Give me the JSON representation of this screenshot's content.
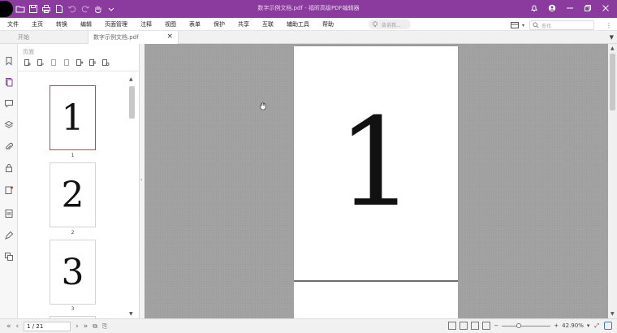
{
  "titlebar": {
    "window_title": "数字示例文档.pdf - 福昕高级PDF编辑器",
    "bg_color": "#8b3a9e"
  },
  "menu": {
    "items": [
      "文件",
      "主页",
      "转换",
      "编辑",
      "页面管理",
      "注释",
      "视图",
      "表单",
      "保护",
      "共享",
      "互联",
      "辅助工具",
      "帮助"
    ],
    "search_placeholder": "告诉我...",
    "find_placeholder": "查找"
  },
  "tabs": {
    "start_label": "开始",
    "doc_label": "数字示例文档.pdf",
    "close_glyph": "×"
  },
  "thumbnails": {
    "panel_title": "页面",
    "pages": [
      {
        "number": "1",
        "label": "1"
      },
      {
        "number": "2",
        "label": "2"
      },
      {
        "number": "3",
        "label": "3"
      }
    ]
  },
  "document": {
    "page1_content": "1"
  },
  "statusbar": {
    "page_value": "1 / 21",
    "zoom_value": "42.90%"
  }
}
